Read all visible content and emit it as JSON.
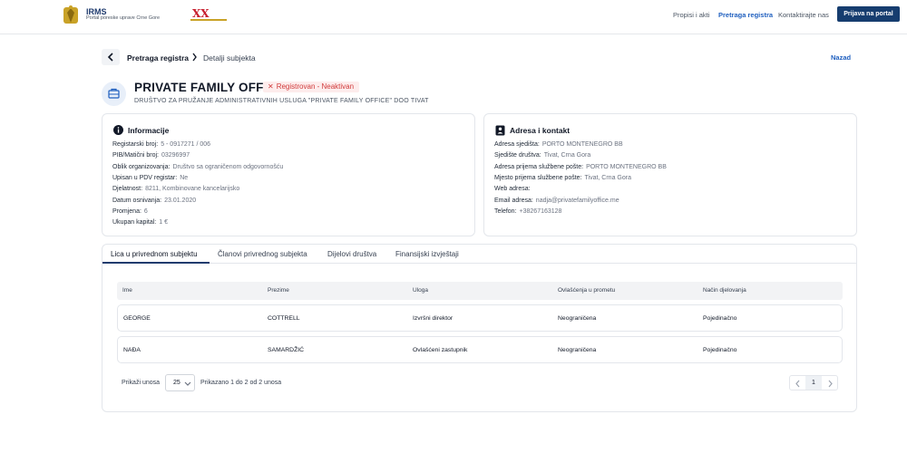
{
  "header": {
    "brand_title": "IRMS",
    "brand_subtitle": "Portal poreske uprave Crne Gore",
    "nav": [
      "Propisi i akti",
      "Pretraga registra",
      "Kontaktirajte nas"
    ],
    "login_label": "Prijava na portal",
    "accent_color": "#163d6f"
  },
  "breadcrumb": {
    "items": [
      "Pretraga registra",
      "Detalji subjekta"
    ],
    "back_label": "Nazad"
  },
  "subject": {
    "name": "PRIVATE FAMILY OFFICE",
    "status": "Registrovan - Neaktivan",
    "status_color": "#d13b3b",
    "full_name": "DRUŠTVO ZA PRUŽANJE ADMINISTRATIVNIH USLUGA \"PRIVATE FAMILY OFFICE\" DOO TIVAT"
  },
  "info": {
    "title": "Informacije",
    "rows": [
      {
        "label": "Registarski broj:",
        "value": "5 - 0917271 / 006"
      },
      {
        "label": "PIB/Matični broj:",
        "value": "03296997"
      },
      {
        "label": "Oblik organizovanja:",
        "value": "Društvo sa ograničenom odgovornošću"
      },
      {
        "label": "Upisan u PDV registar:",
        "value": "Ne"
      },
      {
        "label": "Djelatnost:",
        "value": "8211, Kombinovane kancelarijsko"
      },
      {
        "label": "Datum osnivanja:",
        "value": "23.01.2020"
      },
      {
        "label": "Promjena:",
        "value": "6"
      },
      {
        "label": "Ukupan kapital:",
        "value": "1 €"
      }
    ]
  },
  "address": {
    "title": "Adresa i kontakt",
    "rows": [
      {
        "label": "Adresa sjedišta:",
        "value": "PORTO MONTENEGRO BB"
      },
      {
        "label": "Sjedište društva:",
        "value": "Tivat, Crna Gora"
      },
      {
        "label": "Adresa prijema službene pošte:",
        "value": "PORTO MONTENEGRO BB"
      },
      {
        "label": "Mjesto prijema službene pošte:",
        "value": "Tivat, Crna Gora"
      },
      {
        "label": "Web adresa:",
        "value": ""
      },
      {
        "label": "Email adresa:",
        "value": "nadja@privatefamilyoffice.me"
      },
      {
        "label": "Telefon:",
        "value": "+38267163128"
      }
    ]
  },
  "tabs": [
    "Lica u privrednom subjektu",
    "Članovi privrednog subjekta",
    "Dijelovi društva",
    "Finansijski izvještaji"
  ],
  "table": {
    "columns": [
      "Ime",
      "Prezime",
      "Uloga",
      "Ovlašćenja u prometu",
      "Način djelovanja"
    ],
    "rows": [
      [
        "GEORGE",
        "COTTRELL",
        "Izvršni direktor",
        "Neograničena",
        "Pojedinačno"
      ],
      [
        "NAĐA",
        "SAMARDŽIĆ",
        "Ovlašćeni zastupnik",
        "Neograničena",
        "Pojedinačno"
      ]
    ]
  },
  "pagination": {
    "show_label": "Prikaži unosa",
    "page_size": "25",
    "summary": "Prikazano 1 do 2 od 2 unosa",
    "current_page": "1"
  }
}
